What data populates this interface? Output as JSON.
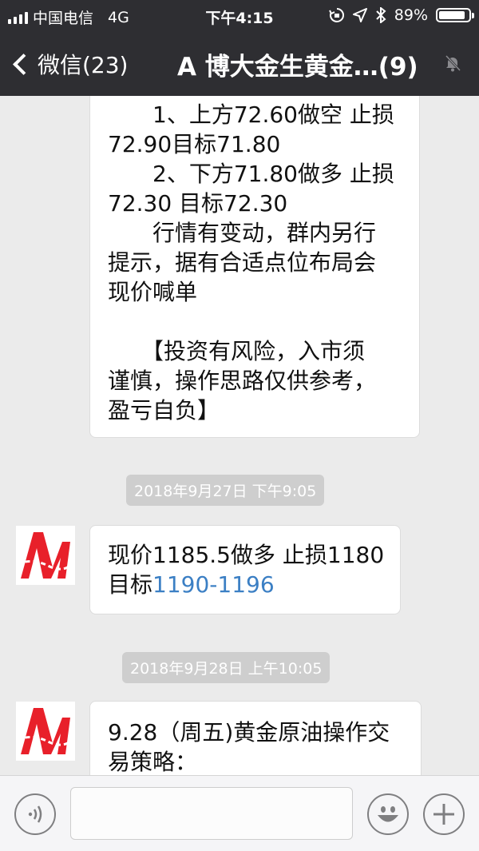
{
  "status_bar": {
    "carrier": "中国电信",
    "network": "4G",
    "time": "下午4:15",
    "battery_text": "89%",
    "battery_level": 0.89
  },
  "nav": {
    "back_label": "微信(23)",
    "title": "A 博大金生黄金…(9)"
  },
  "messages": [
    {
      "lines": [
        "　　1、上方72.60做空 止损",
        "72.90目标71.80",
        "　　2、下方71.80做多 止损",
        "72.30 目标72.30",
        "　　行情有变动，群内另行",
        "提示，据有合适点位布局会",
        "现价喊单",
        "",
        "　　【投资有风险，入市须",
        "谨慎，操作思路仅供参考，",
        "盈亏自负】"
      ]
    },
    {
      "timestamp": "2018年9月27日 下午9:05",
      "line1": "现价1185.5做多 止损1180",
      "line2_prefix": "目标",
      "line2_link": "1190-1196"
    },
    {
      "timestamp": "2018年9月28日 上午10:05",
      "line1": "9.28（周五)黄金原油操作交",
      "line2": "易策略："
    }
  ],
  "colors": {
    "header": "#2e2e32",
    "chat_background": "#ebebeb",
    "link": "#3b7fc4",
    "avatar_logo": "#e8202a"
  },
  "icons": {
    "voice": "voice-icon",
    "emoji": "emoji-icon",
    "plus": "plus-icon",
    "mute": "mute-icon",
    "back": "chevron-left-icon"
  }
}
